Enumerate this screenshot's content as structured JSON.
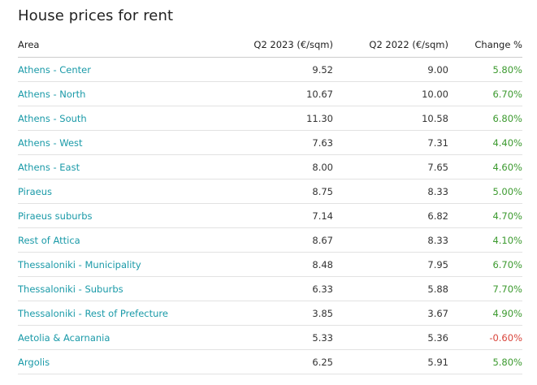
{
  "page": {
    "title": "House prices for rent"
  },
  "table": {
    "headers": {
      "area": "Area",
      "q2_2023": "Q2 2023 (€/sqm)",
      "q2_2022": "Q2 2022 (€/sqm)",
      "change": "Change %"
    },
    "rows": [
      {
        "area": "Athens - Center",
        "q2_2023": "9.52",
        "q2_2022": "9.00",
        "change": "5.80%",
        "trend": "pos"
      },
      {
        "area": "Athens - North",
        "q2_2023": "10.67",
        "q2_2022": "10.00",
        "change": "6.70%",
        "trend": "pos"
      },
      {
        "area": "Athens - South",
        "q2_2023": "11.30",
        "q2_2022": "10.58",
        "change": "6.80%",
        "trend": "pos"
      },
      {
        "area": "Athens - West",
        "q2_2023": "7.63",
        "q2_2022": "7.31",
        "change": "4.40%",
        "trend": "pos"
      },
      {
        "area": "Athens - East",
        "q2_2023": "8.00",
        "q2_2022": "7.65",
        "change": "4.60%",
        "trend": "pos"
      },
      {
        "area": "Piraeus",
        "q2_2023": "8.75",
        "q2_2022": "8.33",
        "change": "5.00%",
        "trend": "pos"
      },
      {
        "area": "Piraeus suburbs",
        "q2_2023": "7.14",
        "q2_2022": "6.82",
        "change": "4.70%",
        "trend": "pos"
      },
      {
        "area": "Rest of Attica",
        "q2_2023": "8.67",
        "q2_2022": "8.33",
        "change": "4.10%",
        "trend": "pos"
      },
      {
        "area": "Thessaloniki - Municipality",
        "q2_2023": "8.48",
        "q2_2022": "7.95",
        "change": "6.70%",
        "trend": "pos"
      },
      {
        "area": "Thessaloniki - Suburbs",
        "q2_2023": "6.33",
        "q2_2022": "5.88",
        "change": "7.70%",
        "trend": "pos"
      },
      {
        "area": "Thessaloniki - Rest of Prefecture",
        "q2_2023": "3.85",
        "q2_2022": "3.67",
        "change": "4.90%",
        "trend": "pos"
      },
      {
        "area": "Aetolia & Acarnania",
        "q2_2023": "5.33",
        "q2_2022": "5.36",
        "change": "-0.60%",
        "trend": "neg"
      },
      {
        "area": "Argolis",
        "q2_2023": "6.25",
        "q2_2022": "5.91",
        "change": "5.80%",
        "trend": "pos"
      }
    ]
  },
  "colors": {
    "link": "#1a9aa8",
    "positive": "#3c9a2f",
    "negative": "#d9453b"
  }
}
